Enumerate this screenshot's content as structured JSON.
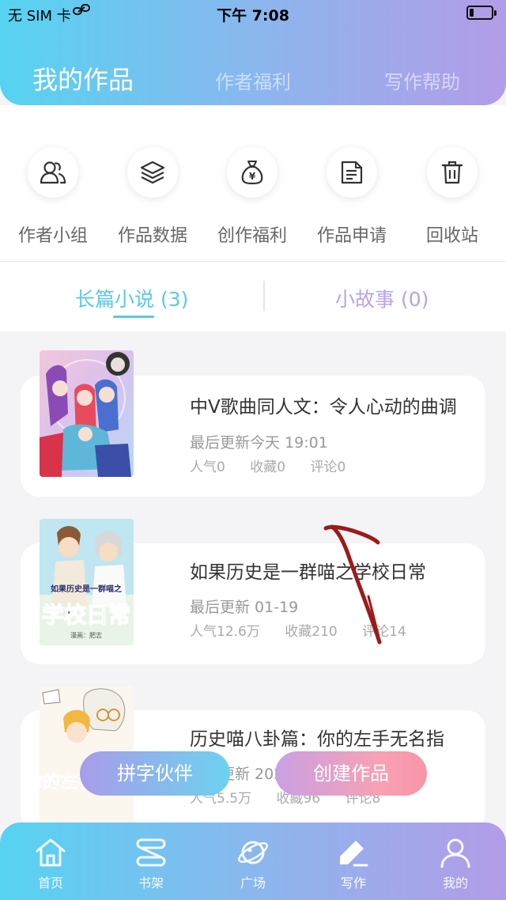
{
  "status_bar": {
    "carrier": "无 SIM 卡",
    "link_icon": "link-icon",
    "time": "下午 7:08",
    "battery_icon": "battery-icon",
    "battery_level": 0.2
  },
  "header": {
    "tabs": [
      {
        "label": "我的作品",
        "active": true
      },
      {
        "label": "作者福利",
        "active": false
      },
      {
        "label": "写作帮助",
        "active": false
      }
    ]
  },
  "quick_actions": [
    {
      "label": "作者小组",
      "icon": "people-icon"
    },
    {
      "label": "作品数据",
      "icon": "layers-icon"
    },
    {
      "label": "创作福利",
      "icon": "money-bag-icon"
    },
    {
      "label": "作品申请",
      "icon": "document-icon"
    },
    {
      "label": "回收站",
      "icon": "trash-icon"
    }
  ],
  "segment": {
    "novel_label": "长篇小说 (3)",
    "story_label": "小故事 (0)",
    "active": "novel"
  },
  "works": [
    {
      "title": "中Ⅴ歌曲同人文：令人心动的曲调",
      "update": "最后更新今天 19:01",
      "popularity": "人气0",
      "favorites": "收藏0",
      "comments": "评论0"
    },
    {
      "title": "如果历史是一群喵之学校日常",
      "update": "最后更新 01-19",
      "popularity": "人气12.6万",
      "favorites": "收藏210",
      "comments": "评论14",
      "cover_text": "如果历史是一群喵之",
      "cover_big": "学校日常",
      "cover_author": "漫画：肥志"
    },
    {
      "title": "历史喵八卦篇：你的左手无名指",
      "update": "最后更新 2021",
      "popularity": "人气5.5万",
      "favorites": "收藏96",
      "comments": "评论8",
      "cover_big": "你的左手无名指"
    }
  ],
  "floating_buttons": {
    "partner": "拼字伙伴",
    "create": "创建作品"
  },
  "bottom_nav": [
    {
      "label": "首页",
      "icon": "home-icon"
    },
    {
      "label": "书架",
      "icon": "bookshelf-icon"
    },
    {
      "label": "广场",
      "icon": "planet-icon"
    },
    {
      "label": "写作",
      "icon": "pen-icon",
      "active": true
    },
    {
      "label": "我的",
      "icon": "user-icon"
    }
  ],
  "colors": {
    "gradient_start": "#56d3f1",
    "gradient_end": "#b39ce8",
    "accent_blue": "#5ac8e8",
    "accent_purple": "#b9a3e6",
    "annotation_red": "#9b1b1b"
  }
}
